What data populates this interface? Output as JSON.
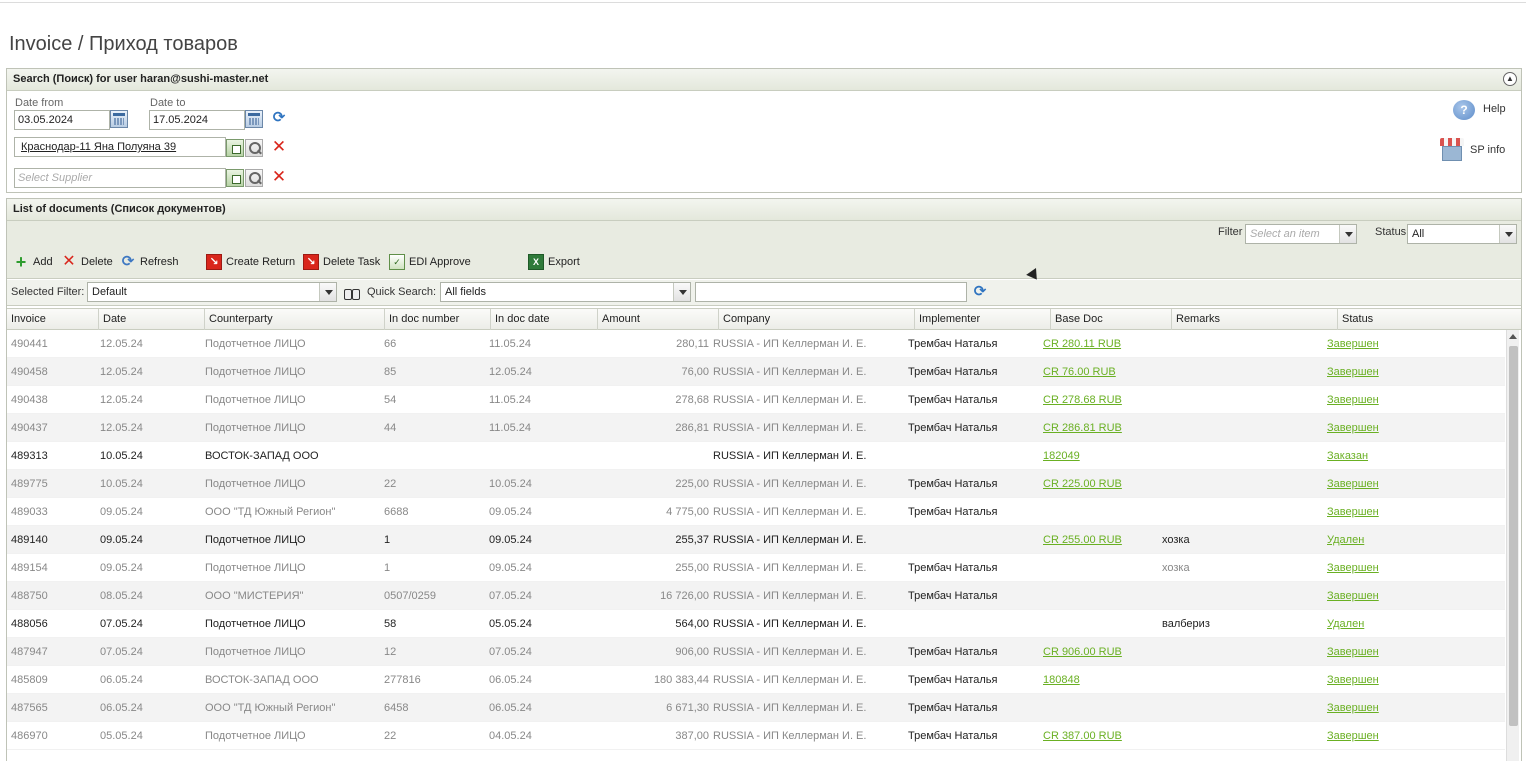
{
  "page": {
    "title": "Invoice / Приход товаров"
  },
  "search": {
    "header": "Search (Поиск) for user haran@sushi-master.net",
    "date_from_label": "Date from",
    "date_from_value": "03.05.2024",
    "date_to_label": "Date to",
    "date_to_value": "17.05.2024",
    "store_value": "Краснодар-11 Яна Полуяна 39",
    "supplier_placeholder": "Select Supplier",
    "help_label": "Help",
    "sp_info_label": "SP info"
  },
  "documents": {
    "header": "List of documents (Список документов)",
    "filter_label": "Filter",
    "filter_placeholder": "Select an item",
    "status_label": "Status",
    "status_value": "All",
    "toolbar": {
      "add": "Add",
      "delete": "Delete",
      "refresh": "Refresh",
      "create_return": "Create Return",
      "delete_task": "Delete Task",
      "edi_approve": "EDI Approve",
      "export": "Export"
    },
    "selected_filter_label": "Selected Filter:",
    "selected_filter_value": "Default",
    "quick_search_label": "Quick Search:",
    "quick_search_field": "All fields",
    "quick_search_value": ""
  },
  "table": {
    "columns": [
      "Invoice",
      "Date",
      "Counterparty",
      "In doc number",
      "In doc date",
      "Amount",
      "Company",
      "Implementer",
      "Base Doc",
      "Remarks",
      "Status"
    ],
    "rows": [
      {
        "invoice": "490441",
        "date": "12.05.24",
        "counterparty": "Подотчетное ЛИЦО",
        "in_doc_number": "66",
        "in_doc_date": "11.05.24",
        "amount": "280,11",
        "company": "RUSSIA - ИП Келлерман И. Е.",
        "implementer": "Трембач Наталья",
        "base_doc": "CR 280.11 RUB",
        "remarks": "",
        "status": "Завершен",
        "active": false
      },
      {
        "invoice": "490458",
        "date": "12.05.24",
        "counterparty": "Подотчетное ЛИЦО",
        "in_doc_number": "85",
        "in_doc_date": "12.05.24",
        "amount": "76,00",
        "company": "RUSSIA - ИП Келлерман И. Е.",
        "implementer": "Трембач Наталья",
        "base_doc": "CR 76.00 RUB",
        "remarks": "",
        "status": "Завершен",
        "active": false
      },
      {
        "invoice": "490438",
        "date": "12.05.24",
        "counterparty": "Подотчетное ЛИЦО",
        "in_doc_number": "54",
        "in_doc_date": "11.05.24",
        "amount": "278,68",
        "company": "RUSSIA - ИП Келлерман И. Е.",
        "implementer": "Трембач Наталья",
        "base_doc": "CR 278.68 RUB",
        "remarks": "",
        "status": "Завершен",
        "active": false
      },
      {
        "invoice": "490437",
        "date": "12.05.24",
        "counterparty": "Подотчетное ЛИЦО",
        "in_doc_number": "44",
        "in_doc_date": "11.05.24",
        "amount": "286,81",
        "company": "RUSSIA - ИП Келлерман И. Е.",
        "implementer": "Трембач Наталья",
        "base_doc": "CR 286.81 RUB",
        "remarks": "",
        "status": "Завершен",
        "active": false
      },
      {
        "invoice": "489313",
        "date": "10.05.24",
        "counterparty": "ВОСТОК-ЗАПАД ООО",
        "in_doc_number": "",
        "in_doc_date": "",
        "amount": "",
        "company": "RUSSIA - ИП Келлерман И. Е.",
        "implementer": "",
        "base_doc": "182049",
        "remarks": "",
        "status": "Заказан",
        "active": true
      },
      {
        "invoice": "489775",
        "date": "10.05.24",
        "counterparty": "Подотчетное ЛИЦО",
        "in_doc_number": "22",
        "in_doc_date": "10.05.24",
        "amount": "225,00",
        "company": "RUSSIA - ИП Келлерман И. Е.",
        "implementer": "Трембач Наталья",
        "base_doc": "CR 225.00 RUB",
        "remarks": "",
        "status": "Завершен",
        "active": false
      },
      {
        "invoice": "489033",
        "date": "09.05.24",
        "counterparty": "ООО \"ТД Южный Регион\"",
        "in_doc_number": "6688",
        "in_doc_date": "09.05.24",
        "amount": "4 775,00",
        "company": "RUSSIA - ИП Келлерман И. Е.",
        "implementer": "Трембач Наталья",
        "base_doc": "",
        "remarks": "",
        "status": "Завершен",
        "active": false
      },
      {
        "invoice": "489140",
        "date": "09.05.24",
        "counterparty": "Подотчетное ЛИЦО",
        "in_doc_number": "1",
        "in_doc_date": "09.05.24",
        "amount": "255,37",
        "company": "RUSSIA - ИП Келлерман И. Е.",
        "implementer": "",
        "base_doc": "CR 255.00 RUB",
        "remarks": "хозка",
        "status": "Удален",
        "active": true
      },
      {
        "invoice": "489154",
        "date": "09.05.24",
        "counterparty": "Подотчетное ЛИЦО",
        "in_doc_number": "1",
        "in_doc_date": "09.05.24",
        "amount": "255,00",
        "company": "RUSSIA - ИП Келлерман И. Е.",
        "implementer": "Трембач Наталья",
        "base_doc": "",
        "remarks": "хозка",
        "status": "Завершен",
        "active": false
      },
      {
        "invoice": "488750",
        "date": "08.05.24",
        "counterparty": "ООО \"МИСТЕРИЯ\"",
        "in_doc_number": "0507/0259",
        "in_doc_date": "07.05.24",
        "amount": "16 726,00",
        "company": "RUSSIA - ИП Келлерман И. Е.",
        "implementer": "Трембач Наталья",
        "base_doc": "",
        "remarks": "",
        "status": "Завершен",
        "active": false
      },
      {
        "invoice": "488056",
        "date": "07.05.24",
        "counterparty": "Подотчетное ЛИЦО",
        "in_doc_number": "58",
        "in_doc_date": "05.05.24",
        "amount": "564,00",
        "company": "RUSSIA - ИП Келлерман И. Е.",
        "implementer": "",
        "base_doc": "",
        "remarks": "валбериз",
        "status": "Удален",
        "active": true
      },
      {
        "invoice": "487947",
        "date": "07.05.24",
        "counterparty": "Подотчетное ЛИЦО",
        "in_doc_number": "12",
        "in_doc_date": "07.05.24",
        "amount": "906,00",
        "company": "RUSSIA - ИП Келлерман И. Е.",
        "implementer": "Трембач Наталья",
        "base_doc": "CR 906.00 RUB",
        "remarks": "",
        "status": "Завершен",
        "active": false
      },
      {
        "invoice": "485809",
        "date": "06.05.24",
        "counterparty": "ВОСТОК-ЗАПАД ООО",
        "in_doc_number": "277816",
        "in_doc_date": "06.05.24",
        "amount": "180 383,44",
        "company": "RUSSIA - ИП Келлерман И. Е.",
        "implementer": "Трембач Наталья",
        "base_doc": "180848",
        "remarks": "",
        "status": "Завершен",
        "active": false
      },
      {
        "invoice": "487565",
        "date": "06.05.24",
        "counterparty": "ООО \"ТД Южный Регион\"",
        "in_doc_number": "6458",
        "in_doc_date": "06.05.24",
        "amount": "6 671,30",
        "company": "RUSSIA - ИП Келлерман И. Е.",
        "implementer": "Трембач Наталья",
        "base_doc": "",
        "remarks": "",
        "status": "Завершен",
        "active": false
      },
      {
        "invoice": "486970",
        "date": "05.05.24",
        "counterparty": "Подотчетное ЛИЦО",
        "in_doc_number": "22",
        "in_doc_date": "04.05.24",
        "amount": "387,00",
        "company": "RUSSIA - ИП Келлерман И. Е.",
        "implementer": "Трембач Наталья",
        "base_doc": "CR 387.00 RUB",
        "remarks": "",
        "status": "Завершен",
        "active": false
      }
    ]
  },
  "icons": {
    "collapse": "chevron-up-icon",
    "calendar": "calendar-icon",
    "refresh": "refresh-icon",
    "clear": "close-icon",
    "help": "help-icon",
    "sp_info": "store-icon",
    "export": "excel-icon"
  },
  "colors": {
    "link": "#6ab023",
    "delete": "#d9261c",
    "toolbar_bg": "#e8ebe1"
  }
}
